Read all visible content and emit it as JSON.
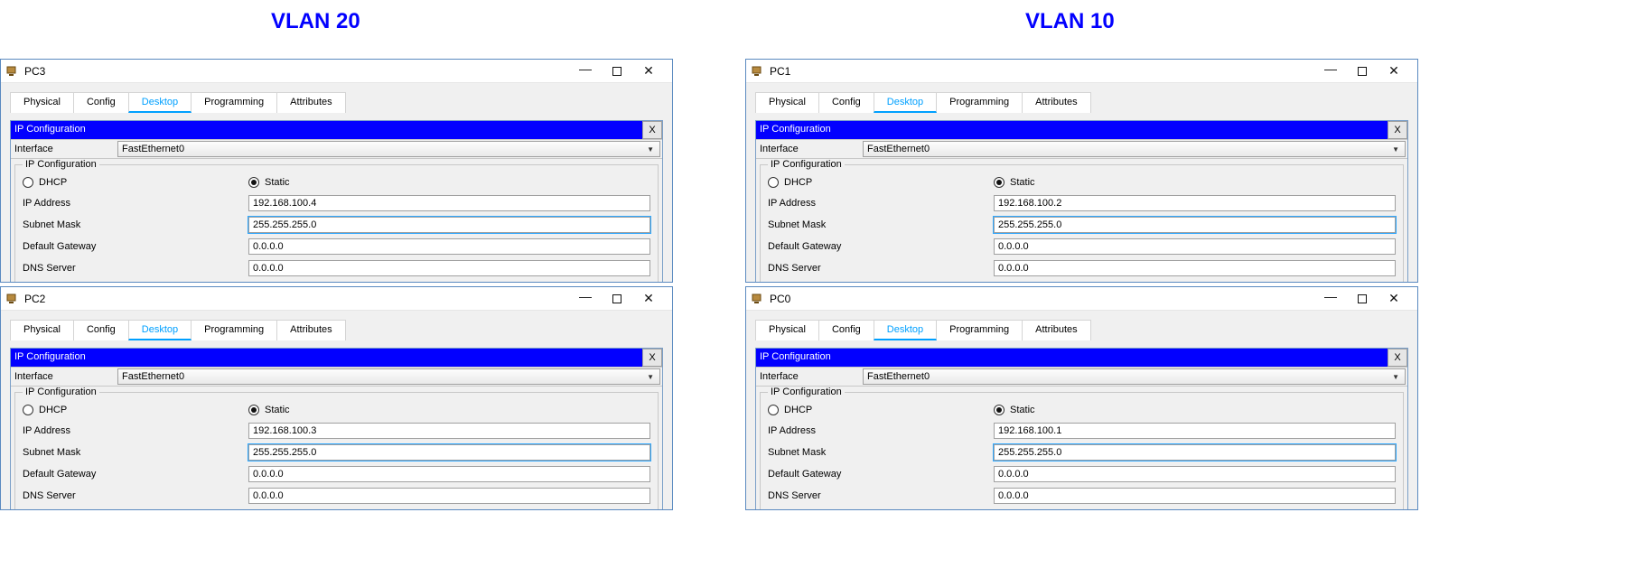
{
  "headings": {
    "left": "VLAN 20",
    "right": "VLAN 10"
  },
  "tabs": [
    "Physical",
    "Config",
    "Desktop",
    "Programming",
    "Attributes"
  ],
  "panel_title": "IP Configuration",
  "iface_label": "Interface",
  "iface_value": "FastEthernet0",
  "fieldset_legend": "IP Configuration",
  "radio_dhcp": "DHCP",
  "radio_static": "Static",
  "labels": {
    "ip": "IP Address",
    "mask": "Subnet Mask",
    "gw": "Default Gateway",
    "dns": "DNS Server"
  },
  "pcs": {
    "pc3": {
      "title": "PC3",
      "ip": "192.168.100.4",
      "mask": "255.255.255.0",
      "gw": "0.0.0.0",
      "dns": "0.0.0.0"
    },
    "pc2": {
      "title": "PC2",
      "ip": "192.168.100.3",
      "mask": "255.255.255.0",
      "gw": "0.0.0.0",
      "dns": "0.0.0.0"
    },
    "pc1": {
      "title": "PC1",
      "ip": "192.168.100.2",
      "mask": "255.255.255.0",
      "gw": "0.0.0.0",
      "dns": "0.0.0.0"
    },
    "pc0": {
      "title": "PC0",
      "ip": "192.168.100.1",
      "mask": "255.255.255.0",
      "gw": "0.0.0.0",
      "dns": "0.0.0.0"
    }
  }
}
